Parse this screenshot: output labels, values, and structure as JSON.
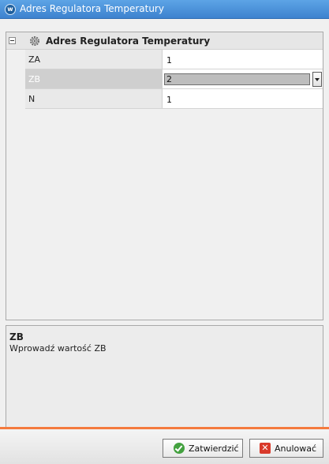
{
  "window": {
    "title": "Adres Regulatora Temperatury"
  },
  "property_grid": {
    "category": {
      "label": "Adres Regulatora Temperatury",
      "icon": "gear-icon",
      "expanded": true
    },
    "rows": [
      {
        "name": "ZA",
        "value": "1",
        "selected": false
      },
      {
        "name": "ZB",
        "value": "2",
        "selected": true
      },
      {
        "name": "N",
        "value": "1",
        "selected": false
      }
    ]
  },
  "description": {
    "title": "ZB",
    "text": "Wprowadź wartość ZB"
  },
  "buttons": {
    "confirm_label": "Zatwierdzić",
    "cancel_label": "Anulować"
  },
  "colors": {
    "titlebar": "#4a90d9",
    "accent_divider": "#f47a3e",
    "confirm_icon": "#43a13f",
    "cancel_icon": "#d93a2b"
  }
}
